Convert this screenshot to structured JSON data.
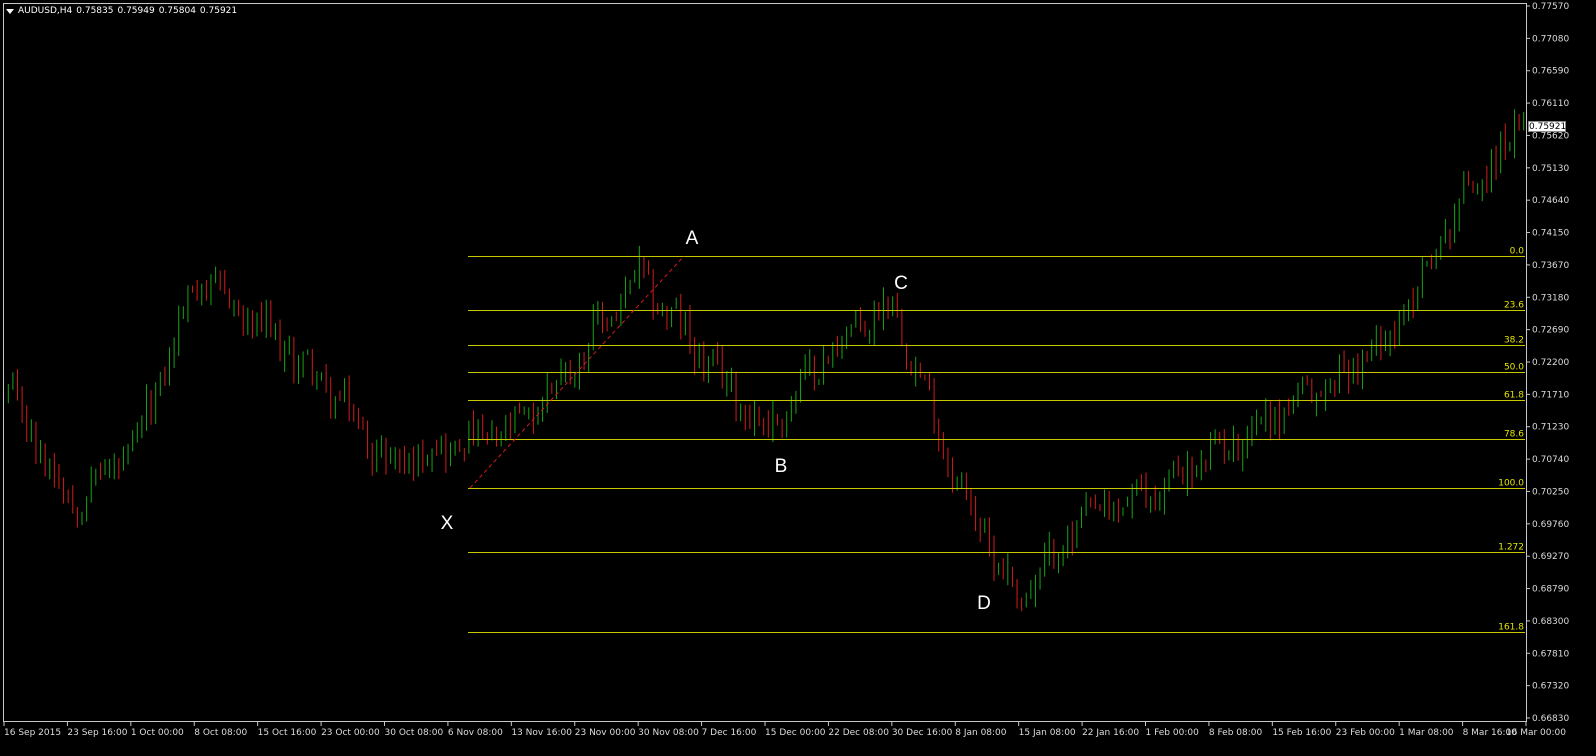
{
  "header": {
    "symbol": "AUDUSD,H4",
    "open": "0.75835",
    "high": "0.75949",
    "low": "0.75804",
    "close": "0.75921"
  },
  "current_price": "0.75921",
  "price_axis": [
    "0.77570",
    "0.77080",
    "0.76590",
    "0.76110",
    "0.75620",
    "0.75130",
    "0.74640",
    "0.74150",
    "0.73670",
    "0.73180",
    "0.72690",
    "0.72200",
    "0.71710",
    "0.71230",
    "0.70740",
    "0.70250",
    "0.69760",
    "0.69270",
    "0.68790",
    "0.68300",
    "0.67810",
    "0.67320",
    "0.66830"
  ],
  "time_axis": [
    "16 Sep 2015",
    "23 Sep 16:00",
    "1 Oct 00:00",
    "8 Oct 08:00",
    "15 Oct 16:00",
    "23 Oct 00:00",
    "30 Oct 08:00",
    "6 Nov 08:00",
    "13 Nov 16:00",
    "23 Nov 00:00",
    "30 Nov 08:00",
    "7 Dec 16:00",
    "15 Dec 00:00",
    "22 Dec 08:00",
    "30 Dec 16:00",
    "8 Jan 08:00",
    "15 Jan 08:00",
    "22 Jan 16:00",
    "1 Feb 00:00",
    "8 Feb 08:00",
    "15 Feb 16:00",
    "23 Feb 00:00",
    "1 Mar 08:00",
    "8 Mar 16:00",
    "16 Mar 00:00"
  ],
  "fib_levels": [
    {
      "label": "0.0",
      "price": 0.7386
    },
    {
      "label": "23.6",
      "price": 0.73
    },
    {
      "label": "38.2",
      "price": 0.7246
    },
    {
      "label": "50.0",
      "price": 0.7203
    },
    {
      "label": "61.8",
      "price": 0.7159
    },
    {
      "label": "78.6",
      "price": 0.7097
    },
    {
      "label": "100.0",
      "price": 0.7019
    },
    {
      "label": "1.272",
      "price": 0.6918
    },
    {
      "label": "161.8",
      "price": 0.6791
    }
  ],
  "wave_labels": [
    "X",
    "A",
    "B",
    "C",
    "D"
  ],
  "colors": {
    "bull": "#16a316",
    "bear": "#d01c1c",
    "fib": "#c8c800",
    "grid": "#c8c8c8",
    "text": "#dcdcdc"
  },
  "chart_data": {
    "type": "candlestick",
    "symbol": "AUDUSD",
    "timeframe": "H4",
    "ylim": [
      0.6658,
      0.7782
    ],
    "x": [
      "16 Sep 2015",
      "23 Sep 16:00",
      "1 Oct 00:00",
      "8 Oct 08:00",
      "15 Oct 16:00",
      "23 Oct 00:00",
      "30 Oct 08:00",
      "6 Nov 08:00",
      "13 Nov 16:00",
      "23 Nov 00:00",
      "30 Nov 08:00",
      "7 Dec 16:00",
      "15 Dec 00:00",
      "22 Dec 08:00",
      "30 Dec 16:00",
      "8 Jan 08:00",
      "15 Jan 08:00",
      "22 Jan 16:00",
      "1 Feb 00:00",
      "8 Feb 08:00",
      "15 Feb 16:00",
      "23 Feb 00:00",
      "1 Mar 08:00",
      "8 Mar 16:00",
      "16 Mar 00:00"
    ],
    "series": [
      {
        "values": [
          0.717,
          0.6995,
          0.708,
          0.7355,
          0.727,
          0.7185,
          0.706,
          0.7085,
          0.711,
          0.7225,
          0.7355,
          0.7225,
          0.711,
          0.7235,
          0.7315,
          0.7035,
          0.684,
          0.697,
          0.7005,
          0.7065,
          0.7135,
          0.7185,
          0.7275,
          0.7475,
          0.7592
        ]
      }
    ],
    "grid": false
  }
}
